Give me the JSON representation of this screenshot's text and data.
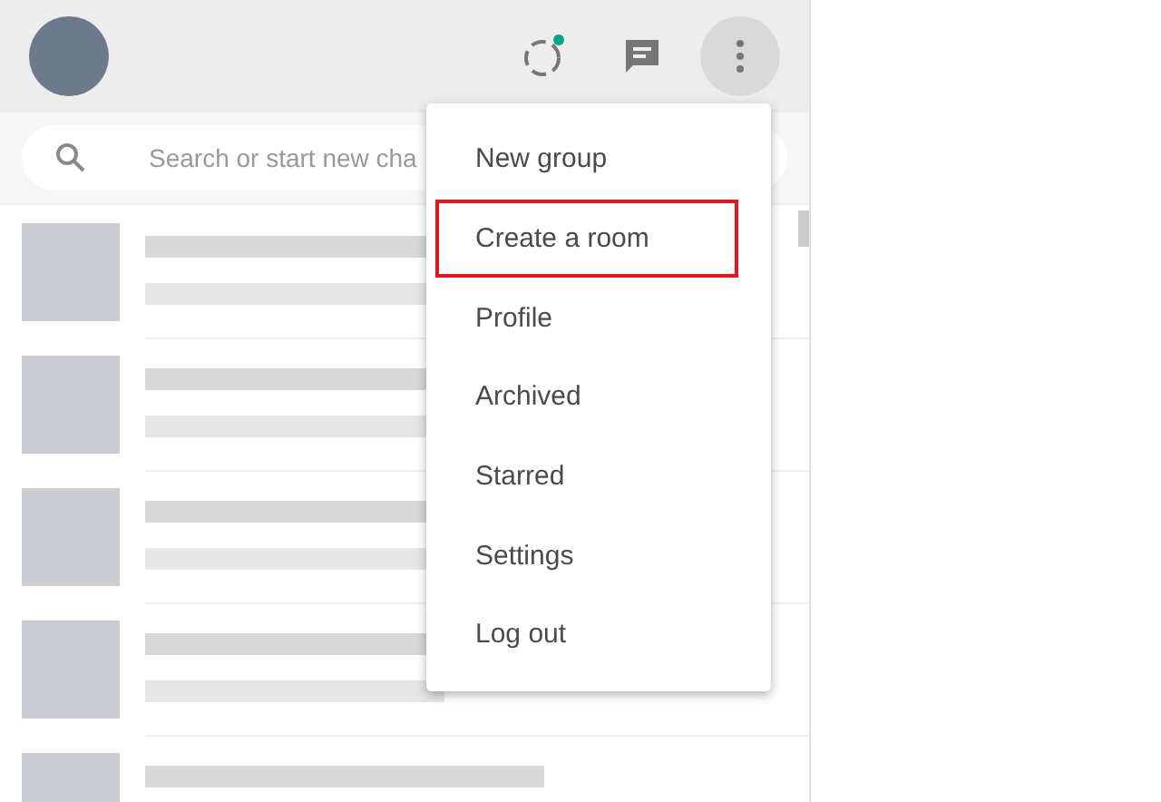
{
  "search": {
    "placeholder": "Search or start new cha"
  },
  "chat_rows": [
    {
      "kind": "blurred"
    },
    {
      "kind": "blurred"
    },
    {
      "kind": "blurred"
    },
    {
      "kind": "blurred"
    },
    {
      "kind": "blurred"
    }
  ],
  "menu": {
    "items": [
      {
        "label": "New group",
        "highlighted": false
      },
      {
        "label": "Create a room",
        "highlighted": true
      },
      {
        "label": "Profile",
        "highlighted": false
      },
      {
        "label": "Archived",
        "highlighted": false
      },
      {
        "label": "Starred",
        "highlighted": false
      },
      {
        "label": "Settings",
        "highlighted": false
      },
      {
        "label": "Log out",
        "highlighted": false
      }
    ]
  }
}
